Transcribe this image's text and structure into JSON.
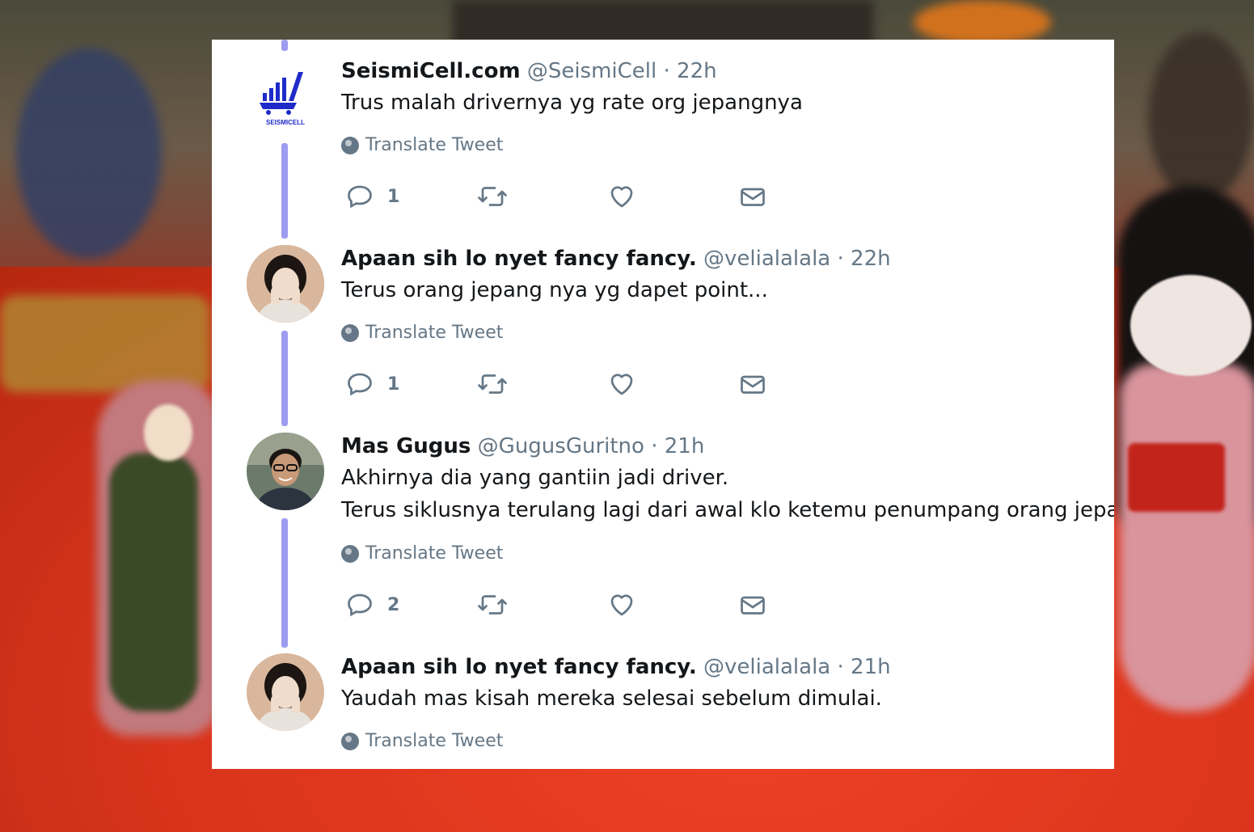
{
  "tweets": [
    {
      "name": "SeismiCell.com",
      "handle": "@SeismiCell",
      "time": "· 22h",
      "lines": [
        "Trus malah drivernya yg rate org jepangnya"
      ],
      "translate_label": "Translate Tweet",
      "reply_count": "1",
      "avatar": "seismicell-logo",
      "logo_text": "SEISMICELL"
    },
    {
      "name": "Apaan sih lo nyet fancy fancy.",
      "handle": "@velialalala",
      "time": "· 22h",
      "lines": [
        "Terus orang jepang nya yg dapet point..."
      ],
      "translate_label": "Translate Tweet",
      "reply_count": "1",
      "avatar": "user-photo"
    },
    {
      "name": "Mas Gugus",
      "handle": "@GugusGuritno",
      "time": "· 21h",
      "lines": [
        "Akhirnya dia yang gantiin jadi driver.",
        "Terus siklusnya terulang lagi dari awal klo ketemu penumpang orang jepang"
      ],
      "translate_label": "Translate Tweet",
      "reply_count": "2",
      "avatar": "user-photo"
    },
    {
      "name": "Apaan sih lo nyet fancy fancy.",
      "handle": "@velialalala",
      "time": "· 21h",
      "lines": [
        "Yaudah mas kisah mereka selesai sebelum dimulai."
      ],
      "translate_label": "Translate Tweet",
      "avatar": "user-photo"
    }
  ],
  "icons": {
    "translate": "globe-icon",
    "reply": "reply-icon",
    "retweet": "retweet-icon",
    "like": "heart-icon",
    "message": "envelope-icon"
  },
  "colors": {
    "thread_line": "#9e9cf0",
    "muted": "#657786",
    "text": "#14171a",
    "logo_blue": "#1f2bc9"
  }
}
